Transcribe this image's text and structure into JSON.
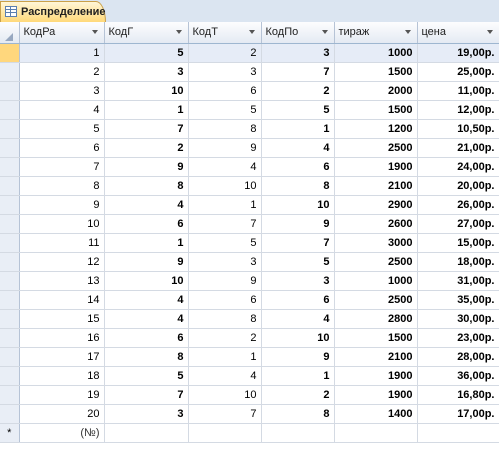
{
  "tab": {
    "label": "Распределение"
  },
  "columns": [
    "КодРа",
    "КодГ",
    "КодТ",
    "КодПо",
    "тираж",
    "цена"
  ],
  "rows": [
    [
      "1",
      "5",
      "2",
      "3",
      "1000",
      "19,00р."
    ],
    [
      "2",
      "3",
      "3",
      "7",
      "1500",
      "25,00р."
    ],
    [
      "3",
      "10",
      "6",
      "2",
      "2000",
      "11,00р."
    ],
    [
      "4",
      "1",
      "5",
      "5",
      "1500",
      "12,00р."
    ],
    [
      "5",
      "7",
      "8",
      "1",
      "1200",
      "10,50р."
    ],
    [
      "6",
      "2",
      "9",
      "4",
      "2500",
      "21,00р."
    ],
    [
      "7",
      "9",
      "4",
      "6",
      "1900",
      "24,00р."
    ],
    [
      "8",
      "8",
      "10",
      "8",
      "2100",
      "20,00р."
    ],
    [
      "9",
      "4",
      "1",
      "10",
      "2900",
      "26,00р."
    ],
    [
      "10",
      "6",
      "7",
      "9",
      "2600",
      "27,00р."
    ],
    [
      "11",
      "1",
      "5",
      "7",
      "3000",
      "15,00р."
    ],
    [
      "12",
      "9",
      "3",
      "5",
      "2500",
      "18,00р."
    ],
    [
      "13",
      "10",
      "9",
      "3",
      "1000",
      "31,00р."
    ],
    [
      "14",
      "4",
      "6",
      "6",
      "2500",
      "35,00р."
    ],
    [
      "15",
      "4",
      "8",
      "4",
      "2800",
      "30,00р."
    ],
    [
      "16",
      "6",
      "2",
      "10",
      "1500",
      "23,00р."
    ],
    [
      "17",
      "8",
      "1",
      "9",
      "2100",
      "28,00р."
    ],
    [
      "18",
      "5",
      "4",
      "1",
      "1900",
      "36,00р."
    ],
    [
      "19",
      "7",
      "10",
      "2",
      "1900",
      "16,80р."
    ],
    [
      "20",
      "3",
      "7",
      "8",
      "1400",
      "17,00р."
    ]
  ],
  "new_row": {
    "marker": "*",
    "placeholder": "(№)"
  },
  "colors": {
    "tab": "#ffd97a",
    "current_row": "#e6ecf7",
    "header": "#e4eaf3"
  }
}
